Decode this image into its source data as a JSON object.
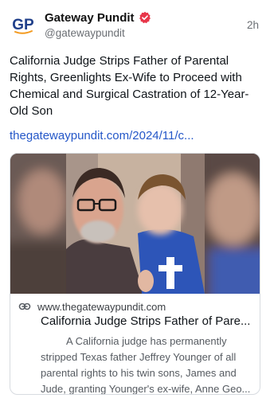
{
  "post": {
    "display_name": "Gateway Pundit",
    "handle": "@gatewaypundit",
    "time": "2h",
    "avatar_logo_text": "GP",
    "verified_icon": "verified-badge-icon",
    "text": "California Judge Strips Father of Parental Rights, Greenlights Ex-Wife to Proceed with Chemical and Surgical Castration of 12-Year-Old Son",
    "link": "thegatewaypundit.com/2024/11/c..."
  },
  "card": {
    "domain": "www.thegatewaypundit.com",
    "title": "California Judge Strips Father of Pare...",
    "description": "A California judge has permanently stripped Texas father Jeffrey Younger of all parental rights to his twin sons, James and Jude, granting Younger's ex-wife, Anne Geo...",
    "link_icon": "link-icon"
  },
  "colors": {
    "link": "#2457c8",
    "verified": "#e8364a",
    "logo_blue": "#1f3f8a",
    "logo_orange": "#f39a1e"
  }
}
